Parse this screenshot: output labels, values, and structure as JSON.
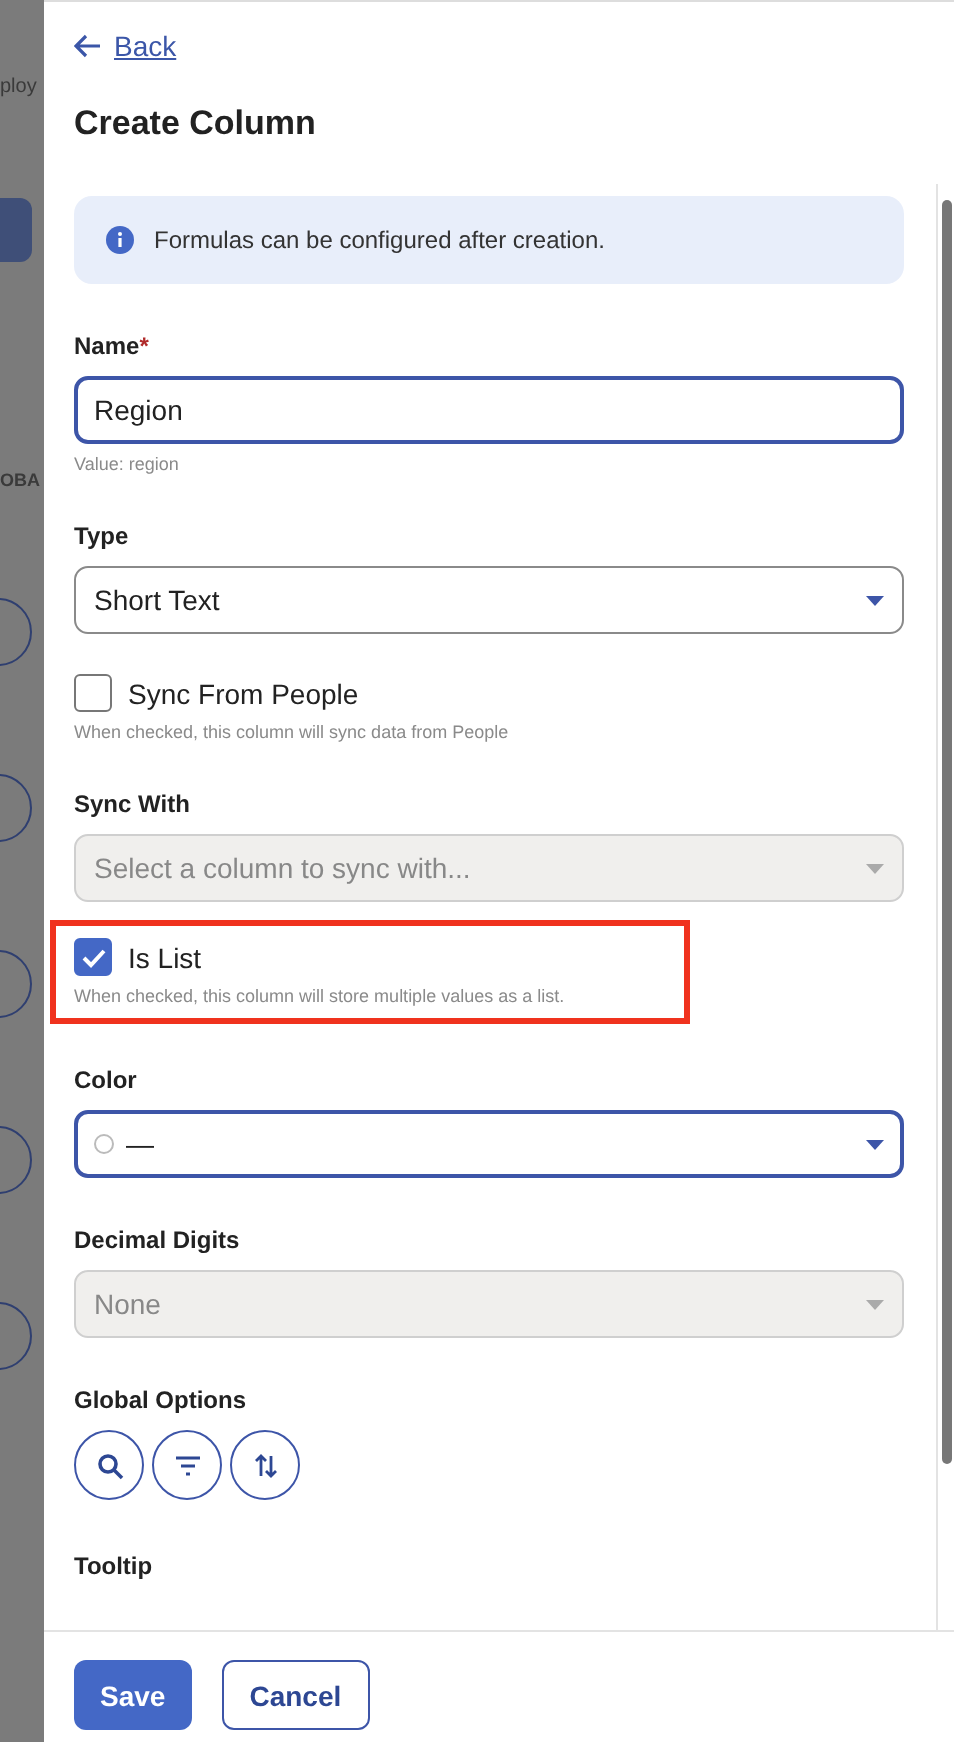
{
  "backdrop": {
    "texts": [
      "ploy",
      "OBA"
    ]
  },
  "back_link": "Back",
  "title": "Create Column",
  "info": "Formulas can be configured after creation.",
  "fields": [
    {
      "kind": "text",
      "label": "Name",
      "required_mark": "*",
      "value": "Region",
      "focused": true,
      "hint": "Value: region"
    },
    {
      "kind": "select",
      "label": "Type",
      "value": "Short Text",
      "focused": false,
      "disabled": false
    },
    {
      "kind": "checkbox",
      "label": "Sync From People",
      "checked": false,
      "hint": "When checked, this column will sync data from People",
      "highlighted": false
    },
    {
      "kind": "select",
      "label": "Sync With",
      "placeholder": "Select a column to sync with...",
      "focused": false,
      "disabled": true
    },
    {
      "kind": "checkbox",
      "label": "Is List",
      "checked": true,
      "hint": "When checked, this column will store multiple values as a list.",
      "highlighted": true
    },
    {
      "kind": "color",
      "label": "Color",
      "value": "—",
      "focused": true
    },
    {
      "kind": "select",
      "label": "Decimal Digits",
      "value": "None",
      "focused": false,
      "disabled": true
    },
    {
      "kind": "options",
      "label": "Global Options",
      "buttons": [
        {
          "kind": "search"
        },
        {
          "kind": "filter"
        },
        {
          "kind": "sort"
        }
      ]
    },
    {
      "kind": "heading",
      "label": "Tooltip"
    }
  ],
  "buttons": [
    {
      "label": "Save",
      "primary": true
    },
    {
      "label": "Cancel",
      "primary": false
    }
  ]
}
